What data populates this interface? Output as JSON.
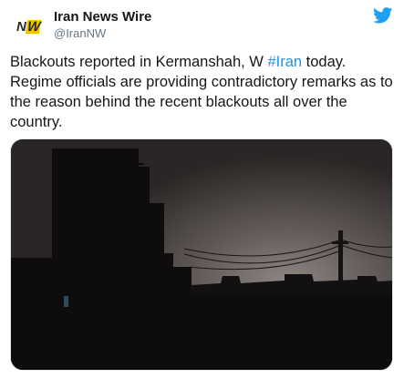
{
  "tweet": {
    "author": {
      "display_name": "Iran News Wire",
      "handle": "@IranNW",
      "avatar_logo_text": "NW"
    },
    "text_before_hashtag": "Blackouts reported in Kermanshah, W ",
    "hashtag": "#Iran",
    "text_after_hashtag": " today. Regime officials are providing contradictory remarks as to the reason behind the recent blackouts all over the country.",
    "platform_icon": "twitter-bird-icon",
    "colors": {
      "hashtag": "#1b95e0",
      "twitter_blue": "#1da1f2",
      "handle_gray": "#657786",
      "logo_yellow": "#f2c200"
    }
  }
}
